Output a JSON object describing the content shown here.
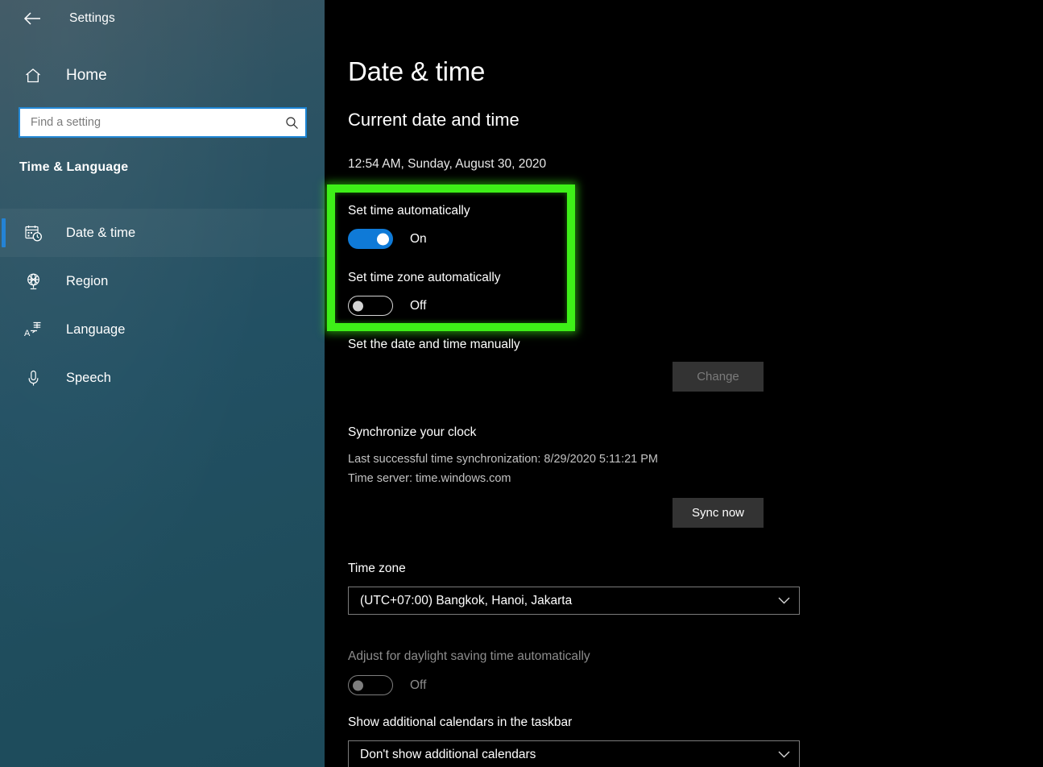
{
  "window": {
    "app_title": "Settings",
    "back_icon": "back-arrow-icon",
    "minimize_label": "—",
    "maximize_label": "□",
    "close_label": "✕"
  },
  "sidebar": {
    "home_label": "Home",
    "home_icon": "home-icon",
    "search": {
      "placeholder": "Find a setting",
      "value": "",
      "icon": "search-icon"
    },
    "section_header": "Time & Language",
    "items": [
      {
        "label": "Date & time",
        "icon": "calendar-clock-icon",
        "selected": true
      },
      {
        "label": "Region",
        "icon": "globe-icon",
        "selected": false
      },
      {
        "label": "Language",
        "icon": "language-translate-icon",
        "selected": false
      },
      {
        "label": "Speech",
        "icon": "microphone-icon",
        "selected": false
      }
    ]
  },
  "main": {
    "page_title": "Date & time",
    "current_section_heading": "Current date and time",
    "current_datetime": "12:54 AM, Sunday, August 30, 2020",
    "set_time_automatically": {
      "label": "Set time automatically",
      "state": "On",
      "enabled": true
    },
    "set_timezone_automatically": {
      "label": "Set time zone automatically",
      "state": "Off",
      "enabled": false
    },
    "set_manually": {
      "label": "Set the date and time manually",
      "button_label": "Change",
      "button_disabled": true
    },
    "synchronize": {
      "heading": "Synchronize your clock",
      "last_sync": "Last successful time synchronization: 8/29/2020 5:11:21 PM",
      "time_server": "Time server: time.windows.com",
      "button_label": "Sync now"
    },
    "time_zone": {
      "label": "Time zone",
      "value": "(UTC+07:00) Bangkok, Hanoi, Jakarta"
    },
    "daylight_saving": {
      "label": "Adjust for daylight saving time automatically",
      "state": "Off",
      "disabled": true
    },
    "additional_calendars": {
      "label": "Show additional calendars in the taskbar",
      "value": "Don't show additional calendars"
    }
  },
  "annotation": {
    "highlight_color": "#3ef018",
    "name": "green-highlight-box"
  }
}
